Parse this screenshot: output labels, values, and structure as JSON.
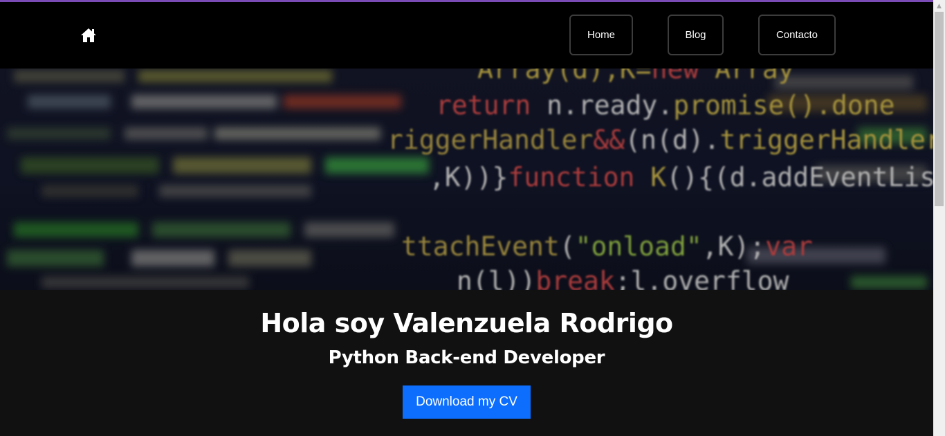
{
  "nav": {
    "home_icon": "home-icon",
    "items": [
      {
        "label": "Home"
      },
      {
        "label": "Blog"
      },
      {
        "label": "Contacto"
      }
    ]
  },
  "hero": {
    "image": "code-editor-background",
    "code_lines": [
      "Array(d),K=new Array(c)",
      "n.ready.promise().done(",
      "triggerHandler&&(n(d).triggerHandler(",
      "\"onload\",K))function K(){(d.addEventListener",
      "attachEvent(\"onload\",K);var c=",
      "n(l))break;l.overflow"
    ]
  },
  "intro": {
    "greeting": "Hola soy ",
    "name": "Valenzuela Rodrigo",
    "role": "Python Back-end Developer",
    "cv_button": "Download my CV"
  },
  "colors": {
    "navbar_bg": "#000000",
    "page_bg": "#111111",
    "accent": "#7b4bb5",
    "button_primary": "#0d6efd"
  }
}
